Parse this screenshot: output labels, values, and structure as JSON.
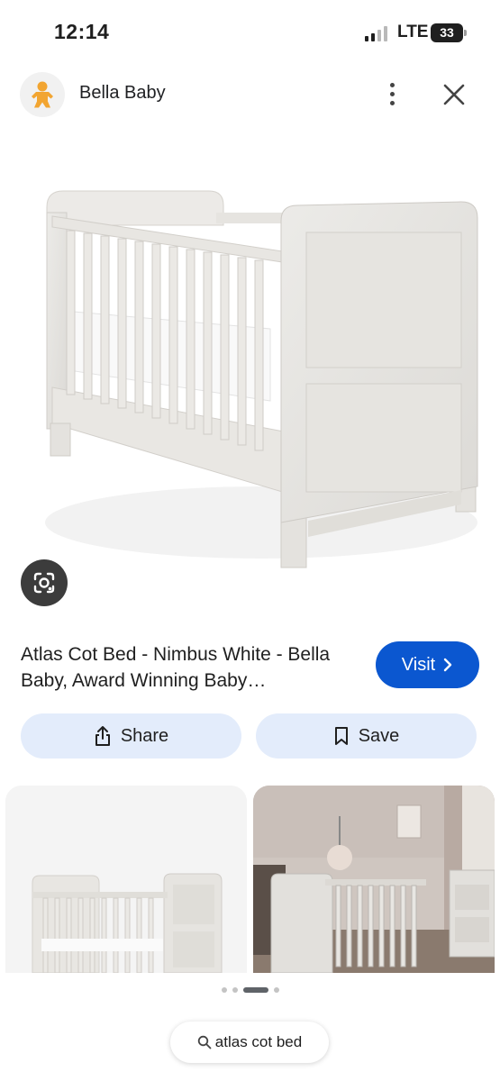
{
  "status_bar": {
    "time": "12:14",
    "network": "LTE",
    "battery": "33"
  },
  "header": {
    "site_name": "Bella Baby",
    "avatar_icon": "baby-icon",
    "more_icon": "more-vert-icon",
    "close_icon": "close-icon"
  },
  "result": {
    "title": "Atlas Cot Bed - Nimbus White - Bella Baby, Award Winning Baby…",
    "visit_label": "Visit",
    "lens_icon": "google-lens-icon"
  },
  "actions": {
    "share_label": "Share",
    "save_label": "Save"
  },
  "search": {
    "query": "atlas cot bed",
    "icon": "search-icon"
  },
  "colors": {
    "accent": "#0b57d0",
    "action_bg": "#e3ecfb",
    "avatar_icon": "#f2a531"
  },
  "pager": {
    "active_index": 2,
    "count": 4
  }
}
